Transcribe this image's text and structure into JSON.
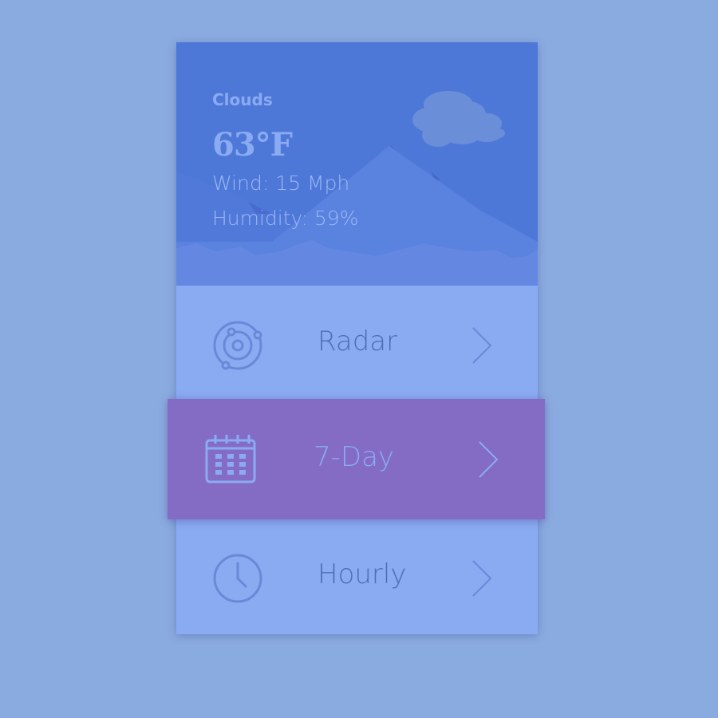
{
  "weather": {
    "condition": "Clouds",
    "temperature": "63°F",
    "wind": "Wind: 15 Mph",
    "humidity": "Humidity: 59%",
    "weather_icon": "cloud-icon"
  },
  "menu": {
    "items": [
      {
        "label": "Radar",
        "icon": "radar-icon",
        "active": false
      },
      {
        "label": "7-Day",
        "icon": "calendar-icon",
        "active": true
      },
      {
        "label": "Hourly",
        "icon": "clock-icon",
        "active": false
      }
    ]
  },
  "colors": {
    "page_background": "#8aabe0",
    "hero_background": "#4e78d8",
    "list_background": "#8aabf2",
    "active_row": "#846cc5",
    "text_muted": "#4e6eb3"
  }
}
